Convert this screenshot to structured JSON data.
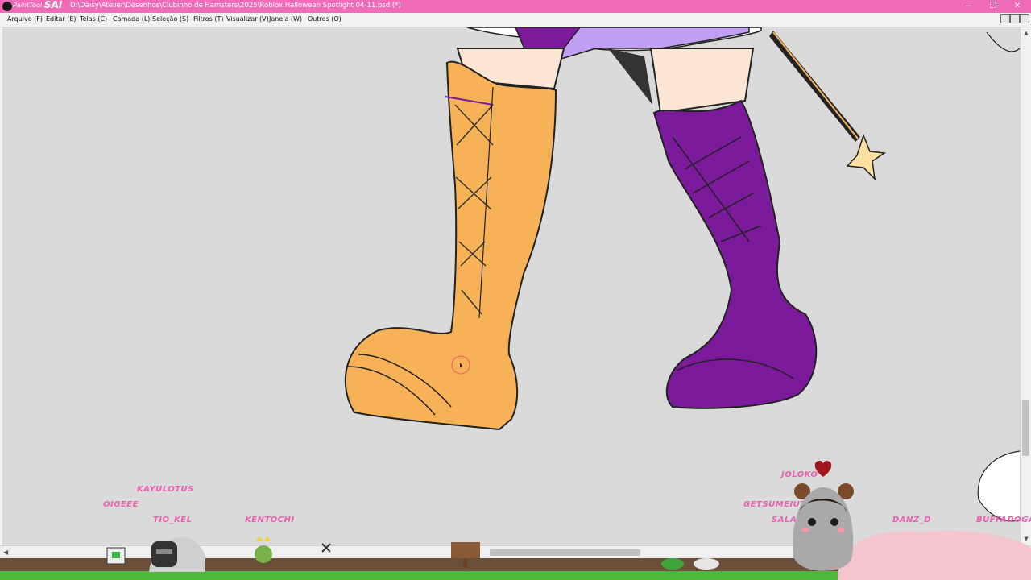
{
  "app": {
    "logo_text_small": "PaintTool",
    "logo_text_big": "SAI",
    "window_title": "D:\\Daisy\\Atelier\\Desenhos\\Clubinho de Hamsters\\2025\\Roblox Halloween Spotlight 04-11.psd (*)"
  },
  "window_controls": {
    "minimize": "—",
    "restore": "❐",
    "close": "✕"
  },
  "menu": [
    {
      "label": "Arquivo (F)"
    },
    {
      "label": "Editar (E)"
    },
    {
      "label": "Telas (C)"
    },
    {
      "label": "Camada (L)"
    },
    {
      "label": "Seleção (S)"
    },
    {
      "label": "Filtros (T)"
    },
    {
      "label": "Visualizar (V)"
    },
    {
      "label": "Janela (W)"
    },
    {
      "label": "Outros (O)"
    }
  ],
  "stream_overlay": {
    "viewers": [
      "KAYULOTUS",
      "OIGEEE",
      "TIO_KEL",
      "KENTOCHI",
      "JOLOKO",
      "GETSUMEIUT",
      "SALA",
      "DANZ_D",
      "BUFFADOGAM"
    ]
  },
  "colors": {
    "titlebar": "#f06cb8",
    "boot_orange": "#f7b257",
    "boot_purple": "#7b1a9a",
    "viewer_name": "#ee5fae"
  },
  "icons": {
    "brush_cursor": "circle-cursor-icon",
    "hamster_avatar": "hamster-icon",
    "heart": "heart-icon"
  }
}
